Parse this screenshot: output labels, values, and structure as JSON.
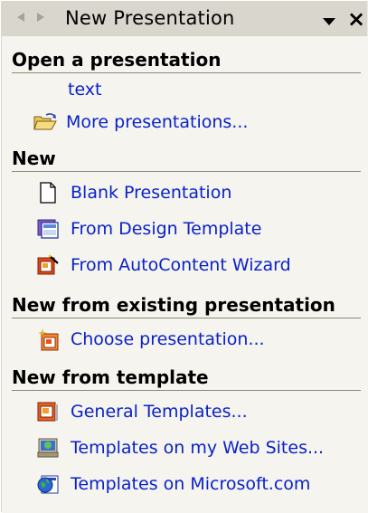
{
  "window": {
    "title": "New Presentation",
    "back_icon": "back-arrow-icon",
    "forward_icon": "forward-arrow-icon",
    "menu_icon": "dropdown-triangle-icon",
    "close_label": "×"
  },
  "sections": {
    "open": {
      "heading": "Open a presentation",
      "items": [
        {
          "label": "text",
          "icon": "none"
        },
        {
          "label": "More presentations...",
          "icon": "open-folder-icon"
        }
      ]
    },
    "new": {
      "heading": "New",
      "items": [
        {
          "label": "Blank Presentation",
          "icon": "blank-page-icon"
        },
        {
          "label": "From Design Template",
          "icon": "design-template-icon"
        },
        {
          "label": "From AutoContent Wizard",
          "icon": "autocontent-wizard-icon"
        }
      ]
    },
    "existing": {
      "heading": "New from existing presentation",
      "items": [
        {
          "label": "Choose presentation...",
          "icon": "sparkle-presentation-icon"
        }
      ]
    },
    "template": {
      "heading": "New from template",
      "items": [
        {
          "label": "General Templates...",
          "icon": "general-templates-icon"
        },
        {
          "label": "Templates on my Web Sites...",
          "icon": "web-sites-icon"
        },
        {
          "label": "Templates on Microsoft.com",
          "icon": "globe-icon"
        }
      ]
    }
  },
  "colors": {
    "link": "#0a22c8",
    "titlebar": "#d8d6cd",
    "panel": "#f5f4ee"
  }
}
